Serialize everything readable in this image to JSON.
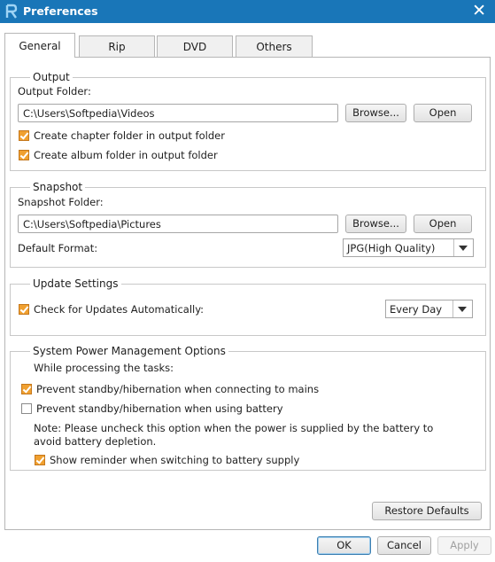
{
  "window": {
    "title": "Preferences"
  },
  "tabs": [
    {
      "label": "General"
    },
    {
      "label": "Rip"
    },
    {
      "label": "DVD"
    },
    {
      "label": "Others"
    }
  ],
  "output": {
    "legend": "Output",
    "folder_label": "Output Folder:",
    "folder_value": "C:\\Users\\Softpedia\\Videos",
    "browse_label": "Browse...",
    "open_label": "Open",
    "chapter_label": "Create chapter folder in output folder",
    "chapter_checked": true,
    "album_label": "Create album folder in output folder",
    "album_checked": true
  },
  "snapshot": {
    "legend": "Snapshot",
    "folder_label": "Snapshot Folder:",
    "folder_value": "C:\\Users\\Softpedia\\Pictures",
    "browse_label": "Browse...",
    "open_label": "Open",
    "format_label": "Default Format:",
    "format_value": "JPG(High Quality)"
  },
  "update": {
    "legend": "Update Settings",
    "check_label": "Check for Updates Automatically:",
    "check_checked": true,
    "frequency_value": "Every Day"
  },
  "power": {
    "legend": "System Power Management Options",
    "while_label": "While processing the tasks:",
    "mains_label": "Prevent standby/hibernation when connecting to mains",
    "mains_checked": true,
    "battery_label": "Prevent standby/hibernation when using battery",
    "battery_checked": false,
    "note": "Note: Please uncheck this option when the power is supplied by the battery to avoid battery depletion.",
    "reminder_label": "Show reminder when switching to battery supply",
    "reminder_checked": true
  },
  "footer": {
    "restore_label": "Restore Defaults",
    "ok_label": "OK",
    "cancel_label": "Cancel",
    "apply_label": "Apply"
  },
  "colors": {
    "titlebar": "#1976b8",
    "checkbox_checked": "#f0a030"
  },
  "icons": {
    "app": "app-logo-icon",
    "close": "close-icon",
    "dropdown": "chevron-down-icon",
    "check": "checkmark-icon"
  }
}
